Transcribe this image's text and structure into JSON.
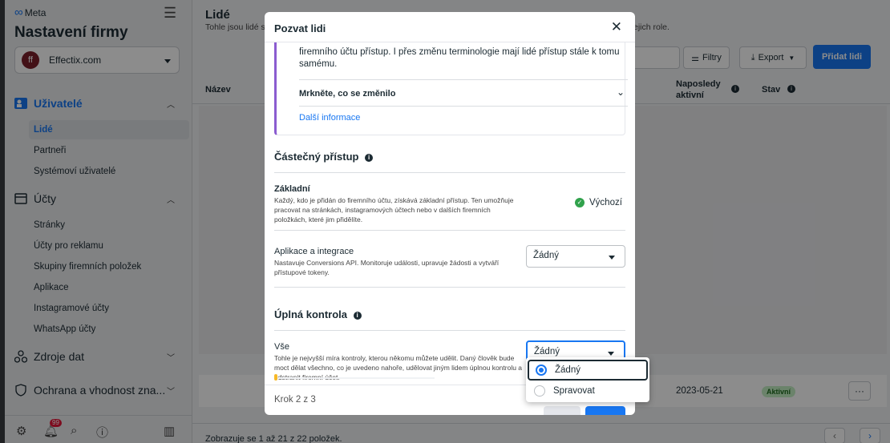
{
  "sidebar": {
    "brand": "Meta",
    "title": "Nastavení firmy",
    "account": {
      "initials": "ff",
      "name": "Effectix.com"
    },
    "users_section": {
      "label": "Uživatelé",
      "items": [
        "Lidé",
        "Partneři",
        "Systémoví uživatelé"
      ]
    },
    "accounts_section": {
      "label": "Účty",
      "items": [
        "Stránky",
        "Účty pro reklamu",
        "Skupiny firemních položek",
        "Aplikace",
        "Instagramové účty",
        "WhatsApp účty"
      ]
    },
    "data_sources": {
      "label": "Zdroje dat"
    },
    "safety": {
      "label": "Ochrana a vhodnost zna..."
    },
    "notifications_count": "99"
  },
  "main": {
    "title": "Lidé",
    "subtitle": "Tohle jsou lidé s",
    "subtitle_end": "ejich role.",
    "toolbar": {
      "filters": "Filtry",
      "export": "Export",
      "add_people": "Přidat lidi"
    },
    "columns": {
      "name": "Název",
      "last_active": "Naposledy aktivní",
      "status": "Stav"
    },
    "row": {
      "date": "2023-05-21",
      "status": "Aktivní",
      "more": "···"
    },
    "footer": "Zobrazuje se 1 až 21 z 22 položek."
  },
  "modal": {
    "title": "Pozvat lidi",
    "notice_text": "firemního účtu přístup. I přes změnu terminologie mají lidé přístup stále k tomu samému.",
    "notice_expand": "Mrkněte, co se změnilo",
    "notice_link": "Další informace",
    "partial_access": {
      "title": "Částečný přístup",
      "basic": {
        "title": "Základní",
        "desc": "Každý, kdo je přidán do firemního účtu, získává základní přístup. Ten umožňuje pracovat na stránkách, instagramových účtech nebo v dalších firemních položkách, které jim přidělíte.",
        "default_label": "Výchozí"
      },
      "apps": {
        "title": "Aplikace a integrace",
        "desc": "Nastavuje Conversions API. Monitoruje události, upravuje žádosti a vytváří přístupové tokeny.",
        "value": "Žádný"
      }
    },
    "full_control": {
      "title": "Úplná kontrola",
      "all": {
        "title": "Vše",
        "desc": "Tohle je nejvyšší míra kontroly, kterou někomu můžete udělit. Daný člověk bude moct dělat všechno, co je uvedeno nahoře, udělovat jiným lidem úplnou kontrolu a odstranit firemní účet.",
        "value": "Žádný"
      }
    },
    "step": "Krok 2 z 3"
  },
  "dropdown": {
    "options": [
      "Žádný",
      "Spravovat"
    ],
    "selected": "Žádný"
  },
  "colors": {
    "accent": "#1877f2",
    "notice_border": "#8b5cd0",
    "success": "#31a24c",
    "badge": "#e4163a"
  }
}
